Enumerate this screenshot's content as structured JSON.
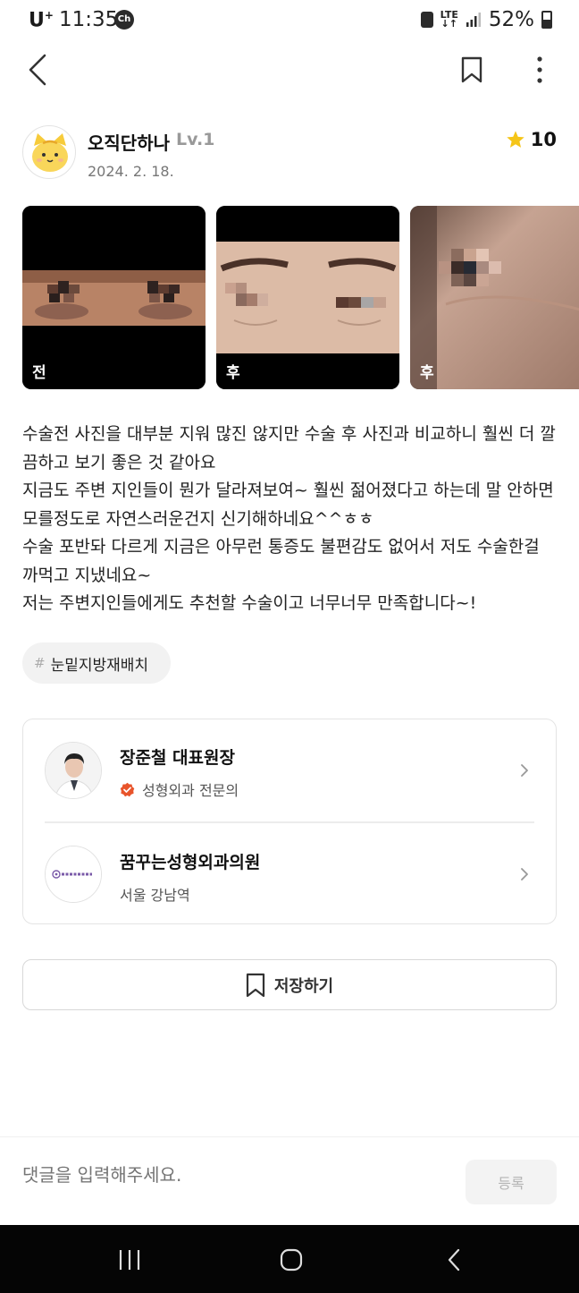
{
  "status_bar": {
    "carrier": "U",
    "carrier_sup": "+",
    "time": "11:35",
    "chat_badge": "Ch",
    "network": "LTE",
    "battery": "52%"
  },
  "author": {
    "name": "오직단하나",
    "level": "Lv.1",
    "date": "2024. 2. 18.",
    "rating": "10"
  },
  "photos": [
    {
      "label": "전"
    },
    {
      "label": "후"
    },
    {
      "label": "후"
    }
  ],
  "review": {
    "text": "수술전 사진을 대부분 지워 많진 않지만 수술 후 사진과 비교하니 훨씬 더 깔끔하고 보기 좋은 것 같아요\n지금도 주변 지인들이 뭔가 달라져보여~ 훨씬 젊어졌다고 하는데 말 안하면 모를정도로 자연스러운건지 신기해하네요^^ㅎㅎ\n수술 포반돠 다르게 지금은 아무런 통증도 불편감도 없어서 저도 수술한걸 까먹고 지냈네요~\n저는 주변지인들에게도 추천할 수술이고 너무너무 만족합니다~!"
  },
  "tag": {
    "hash": "#",
    "label": "눈밑지방재배치"
  },
  "doctor": {
    "name": "장준철 대표원장",
    "specialty": "성형외과 전문의"
  },
  "clinic": {
    "name": "꿈꾸는성형외과의원",
    "location": "서울 강남역",
    "logo_text": "꿈꾸는성형외과"
  },
  "save_button": {
    "label": "저장하기"
  },
  "comment": {
    "placeholder": "댓글을 입력해주세요.",
    "submit_label": "등록"
  },
  "colors": {
    "star": "#F5C518",
    "verified_badge": "#E8542B",
    "nav_bar": "#050505"
  }
}
